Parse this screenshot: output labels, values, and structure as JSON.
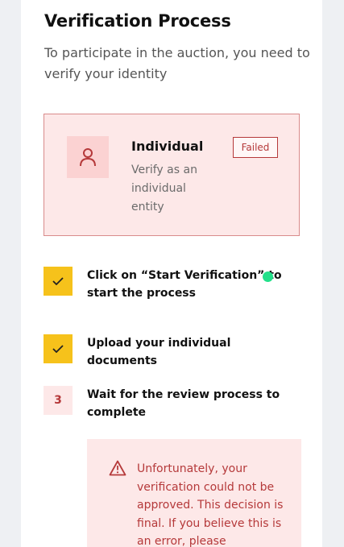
{
  "header": {
    "title": "Verification Process",
    "subtitle": "To participate in the auction, you need to verify your identity"
  },
  "card": {
    "icon": "user-icon",
    "title": "Individual",
    "description": "Verify as an individual entity",
    "status": "Failed"
  },
  "steps": [
    {
      "marker": "check-icon",
      "text": "Click on “Start Verification” to start the process"
    },
    {
      "marker": "check-icon",
      "text": "Upload your individual documents"
    },
    {
      "marker": "3",
      "text": "Wait for the review process to complete"
    }
  ],
  "error": {
    "icon": "warning-icon",
    "text": "Unfortunately, your verification could not be approved. This decision is final. If you believe this is an error, please"
  },
  "colors": {
    "accent_red": "#b5393a",
    "card_bg": "#fde8e8",
    "check_yellow": "#f6c21b",
    "cursor_green": "#22e08a"
  }
}
